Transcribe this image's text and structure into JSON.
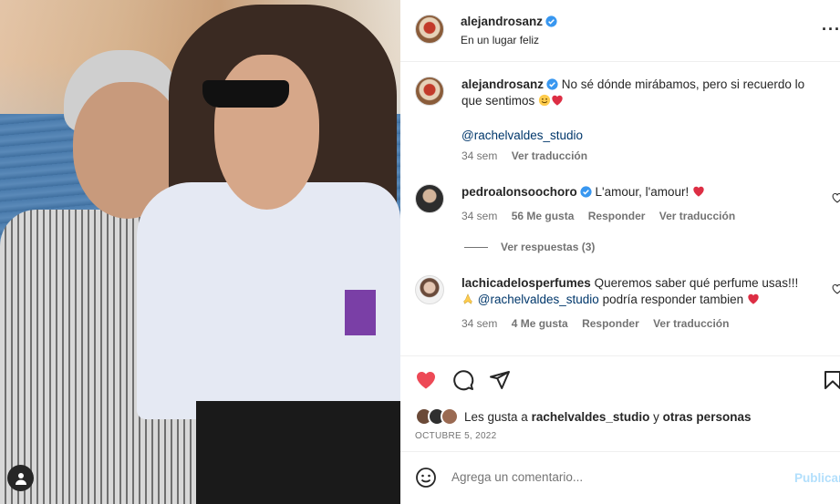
{
  "post": {
    "author": "alejandrosanz",
    "location": "En un lugar feliz",
    "more_icon": "ellipsis-icon"
  },
  "caption": {
    "author": "alejandrosanz",
    "text": "No sé dónde mirábamos, pero si recuerdo lo que sentimos",
    "mention": "@rachelvaldes_studio",
    "time": "34 sem",
    "translate": "Ver traducción"
  },
  "comments": [
    {
      "author": "pedroalonsoochoro",
      "verified": true,
      "text": "L'amour, l'amour!",
      "time": "34 sem",
      "likes": "56 Me gusta",
      "reply": "Responder",
      "translate": "Ver traducción",
      "replies": "Ver respuestas (3)"
    },
    {
      "author": "lachicadelosperfumes",
      "verified": false,
      "text": "Queremos saber qué perfume usas!!!",
      "mention": "@rachelvaldes_studio",
      "text2": "podría responder tambien",
      "time": "34 sem",
      "likes": "4 Me gusta",
      "reply": "Responder",
      "translate": "Ver traducción"
    }
  ],
  "likes": {
    "prefix": "Les gusta a",
    "user": "rachelvaldes_studio",
    "joiner": "y",
    "others": "otras personas"
  },
  "date": "OCTUBRE 5, 2022",
  "composer": {
    "placeholder": "Agrega un comentario...",
    "publish": "Publicar"
  },
  "colors": {
    "liked_heart": "#ed4956",
    "link": "#00376b",
    "verified": "#3897f0",
    "publish_disabled": "#b2dffc"
  }
}
